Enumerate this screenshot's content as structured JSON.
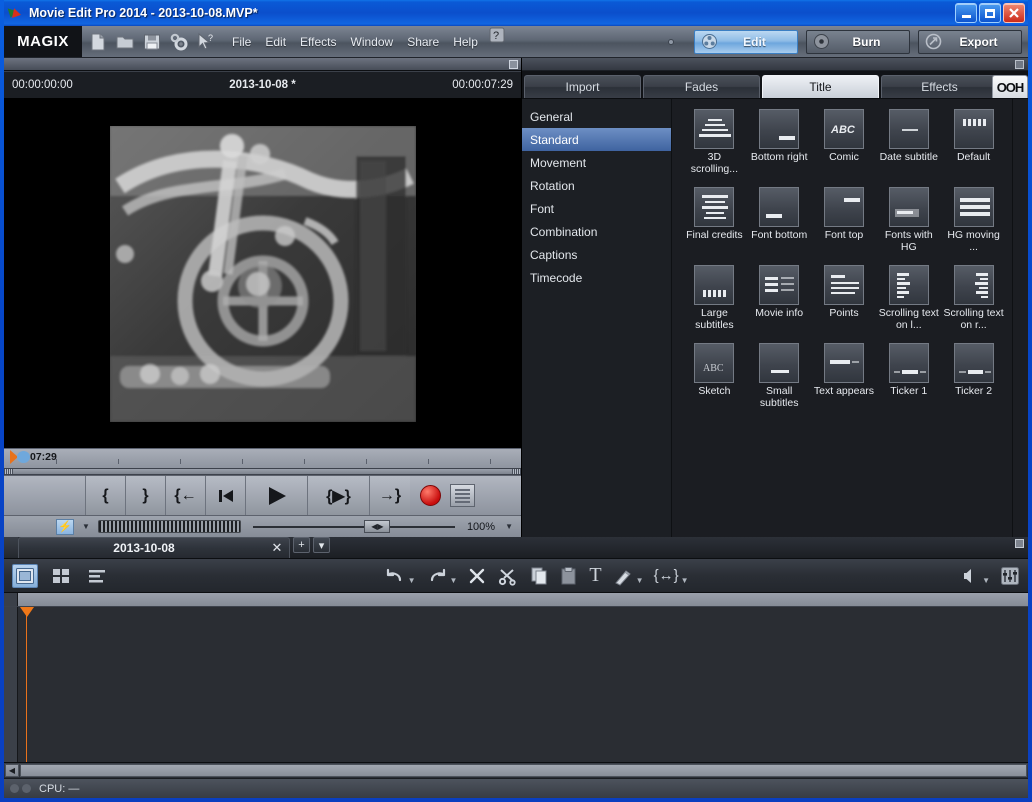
{
  "window": {
    "title": "Movie Edit Pro 2014 - 2013-10-08.MVP*",
    "app_icon": "magix-leaf-icon",
    "minimize": "–",
    "maximize": "□",
    "close": "✕"
  },
  "toolbar": {
    "brand": "MAGIX",
    "icons": [
      {
        "name": "new-project-icon"
      },
      {
        "name": "open-project-icon"
      },
      {
        "name": "save-project-icon"
      },
      {
        "name": "settings-gear-icon"
      },
      {
        "name": "help-pointer-icon"
      }
    ],
    "menus": [
      "File",
      "Edit",
      "Effects",
      "Window",
      "Share",
      "Help"
    ],
    "help_badge": "?",
    "modes": [
      {
        "label": "Edit",
        "icon": "film-reel-icon",
        "active": true
      },
      {
        "label": "Burn",
        "icon": "disc-icon",
        "active": false
      },
      {
        "label": "Export",
        "icon": "export-arrow-icon",
        "active": false
      }
    ]
  },
  "monitor": {
    "timecode_start": "00:00:00:00",
    "project_name": "2013-10-08 *",
    "timecode_end": "00:00:07:29",
    "scrub_label": "07:29",
    "transport": [
      {
        "name": "set-in-point-button",
        "glyph": "{"
      },
      {
        "name": "set-out-point-button",
        "glyph": "}"
      },
      {
        "name": "jump-to-in-button",
        "glyph": "{←"
      },
      {
        "name": "jump-to-start-button",
        "glyph": "⏮"
      },
      {
        "name": "play-button",
        "glyph": "▶"
      },
      {
        "name": "play-range-button",
        "glyph": "{▶}"
      },
      {
        "name": "jump-to-out-button",
        "glyph": "→}"
      }
    ],
    "record_button": "record",
    "list_button": "playlist",
    "bolt_button": "⚡",
    "zoom_level": "100%"
  },
  "mediapool": {
    "tabs": [
      {
        "label": "Import",
        "active": false
      },
      {
        "label": "Fades",
        "active": false
      },
      {
        "label": "Title",
        "active": true
      },
      {
        "label": "Effects",
        "active": false
      }
    ],
    "badge": "OOH",
    "categories": [
      {
        "label": "General",
        "selected": false
      },
      {
        "label": "Standard",
        "selected": true
      },
      {
        "label": "Movement",
        "selected": false
      },
      {
        "label": "Rotation",
        "selected": false
      },
      {
        "label": "Font",
        "selected": false
      },
      {
        "label": "Combination",
        "selected": false
      },
      {
        "label": "Captions",
        "selected": false
      },
      {
        "label": "Timecode",
        "selected": false
      }
    ],
    "templates": [
      {
        "label": "3D scrolling...",
        "thumb": "stack-3d"
      },
      {
        "label": "Bottom right",
        "thumb": "bar-bottom-right"
      },
      {
        "label": "Comic",
        "thumb": "abc-comic"
      },
      {
        "label": "Date subtitle",
        "thumb": "dots-center"
      },
      {
        "label": "Default",
        "thumb": "blocks-top"
      },
      {
        "label": "Final credits",
        "thumb": "credits-lines"
      },
      {
        "label": "Font bottom",
        "thumb": "bar-bottom-left"
      },
      {
        "label": "Font top",
        "thumb": "bar-top-right"
      },
      {
        "label": "Fonts with HG",
        "thumb": "bar-with-bg"
      },
      {
        "label": "HG moving ...",
        "thumb": "three-lines"
      },
      {
        "label": "Large subtitles",
        "thumb": "blocks-bottom"
      },
      {
        "label": "Movie info",
        "thumb": "two-col-info"
      },
      {
        "label": "Points",
        "thumb": "points-lines"
      },
      {
        "label": "Scrolling text on l...",
        "thumb": "scroll-left"
      },
      {
        "label": "Scrolling text on r...",
        "thumb": "scroll-right"
      },
      {
        "label": "Sketch",
        "thumb": "abc-sketch"
      },
      {
        "label": "Small subtitles",
        "thumb": "small-bar"
      },
      {
        "label": "Text appears",
        "thumb": "text-appear"
      },
      {
        "label": "Ticker 1",
        "thumb": "ticker-one"
      },
      {
        "label": "Ticker 2",
        "thumb": "ticker-two"
      }
    ]
  },
  "timeline": {
    "tab_name": "2013-10-08",
    "close_label": "✕",
    "add_label": "+",
    "dropdown_label": "▾",
    "view_buttons": [
      {
        "name": "timeline-view-button",
        "glyph": "▣",
        "active": true
      },
      {
        "name": "storyboard-view-button",
        "glyph": "▦",
        "active": false
      },
      {
        "name": "scene-overview-button",
        "glyph": "≡",
        "active": false
      }
    ],
    "tools": [
      {
        "name": "undo-button",
        "glyph": "↶",
        "caret": true
      },
      {
        "name": "redo-button",
        "glyph": "↷",
        "caret": true
      },
      {
        "name": "delete-button",
        "glyph": "✕",
        "caret": false
      },
      {
        "name": "cut-button",
        "glyph": "✂",
        "caret": false
      },
      {
        "name": "copy-button",
        "glyph": "❐",
        "caret": false
      },
      {
        "name": "paste-button",
        "glyph": "❑",
        "caret": false
      },
      {
        "name": "text-title-button",
        "glyph": "T",
        "caret": false
      },
      {
        "name": "magic-wand-button",
        "glyph": "✐",
        "caret": true
      },
      {
        "name": "range-tool-button",
        "glyph": "{↔}",
        "caret": true
      }
    ],
    "right_tools": [
      {
        "name": "mute-speaker-button",
        "glyph": "◀",
        "caret": true
      },
      {
        "name": "mixer-button",
        "glyph": "⚙",
        "caret": false
      }
    ]
  },
  "status": {
    "cpu_label": "CPU: —"
  },
  "colors": {
    "accent_blue": "#0a5fe0",
    "playhead_orange": "#f07818",
    "selection_blue": "#3f63a0",
    "record_red": "#c80d0d",
    "panel_dark": "#1b1d22"
  }
}
